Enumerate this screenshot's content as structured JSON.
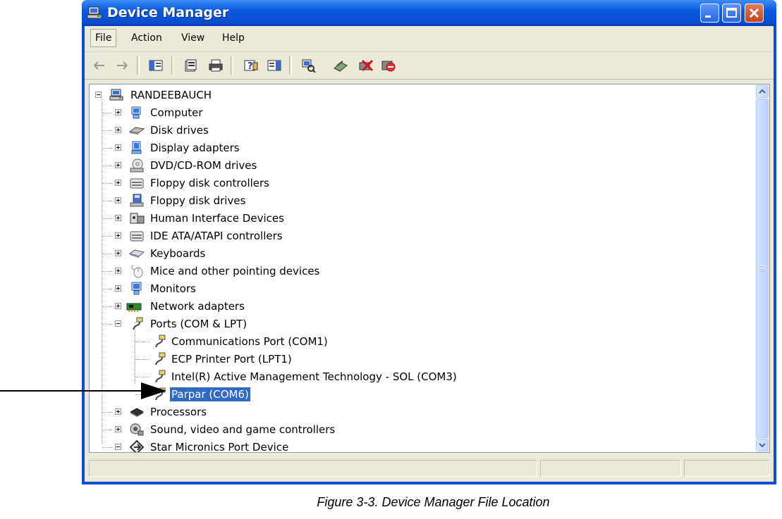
{
  "window": {
    "title": "Device Manager"
  },
  "menubar": {
    "items": [
      "File",
      "Action",
      "View",
      "Help"
    ]
  },
  "toolbar": {
    "tools": [
      "back-icon",
      "forward-icon",
      "show-hide-console-tree-icon",
      "properties-icon",
      "print-icon",
      "help-icon",
      "show-hide-action-pane-icon",
      "scan-hardware-icon",
      "update-driver-icon",
      "uninstall-icon",
      "disable-icon"
    ]
  },
  "tree": {
    "root": "RANDEEBAUCH",
    "categories": [
      {
        "label": "Computer",
        "icon": "computer-icon",
        "expanded": false
      },
      {
        "label": "Disk drives",
        "icon": "disk-drive-icon",
        "expanded": false
      },
      {
        "label": "Display adapters",
        "icon": "display-adapter-icon",
        "expanded": false
      },
      {
        "label": "DVD/CD-ROM drives",
        "icon": "dvd-drive-icon",
        "expanded": false
      },
      {
        "label": "Floppy disk controllers",
        "icon": "floppy-controller-icon",
        "expanded": false
      },
      {
        "label": "Floppy disk drives",
        "icon": "floppy-drive-icon",
        "expanded": false
      },
      {
        "label": "Human Interface Devices",
        "icon": "hid-icon",
        "expanded": false
      },
      {
        "label": "IDE ATA/ATAPI controllers",
        "icon": "ide-controller-icon",
        "expanded": false
      },
      {
        "label": "Keyboards",
        "icon": "keyboard-icon",
        "expanded": false
      },
      {
        "label": "Mice and other pointing devices",
        "icon": "mouse-icon",
        "expanded": false
      },
      {
        "label": "Monitors",
        "icon": "monitor-icon",
        "expanded": false
      },
      {
        "label": "Network adapters",
        "icon": "network-adapter-icon",
        "expanded": false
      },
      {
        "label": "Ports (COM & LPT)",
        "icon": "port-icon",
        "expanded": true,
        "children": [
          "Communications Port (COM1)",
          "ECP Printer Port (LPT1)",
          "Intel(R) Active Management Technology - SOL (COM3)",
          "Parpar (COM6)"
        ],
        "selected_child": "Parpar (COM6)"
      },
      {
        "label": "Processors",
        "icon": "processor-icon",
        "expanded": false
      },
      {
        "label": "Sound, video and game controllers",
        "icon": "sound-icon",
        "expanded": false
      },
      {
        "label": "Star Micronics Port Device",
        "icon": "star-port-icon",
        "expanded": true
      }
    ]
  },
  "caption": "Figure 3-3. Device Manager File Location",
  "colors": {
    "titlebar": "#0a4fd4",
    "selection": "#316ac5",
    "chrome": "#ece9d8"
  }
}
